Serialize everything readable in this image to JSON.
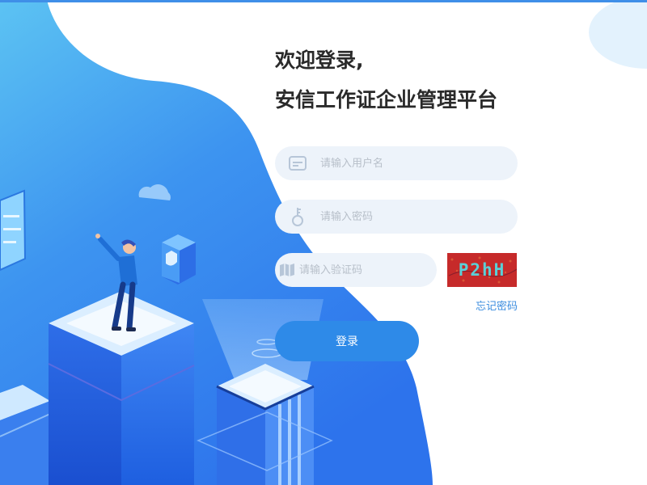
{
  "login": {
    "title_line1": "欢迎登录,",
    "title_line2": "安信工作证企业管理平台",
    "username": {
      "placeholder": "请输入用户名",
      "value": "",
      "icon": "id-card-icon"
    },
    "password": {
      "placeholder": "请输入密码",
      "value": "",
      "icon": "key-icon"
    },
    "captcha_input": {
      "placeholder": "请输入验证码",
      "value": "",
      "icon": "map-icon"
    },
    "captcha_image": {
      "text": "P2hH",
      "icon": "captcha-image"
    },
    "forgot_password": "忘记密码",
    "submit_label": "登录"
  },
  "colors": {
    "accent": "#2e8ae8",
    "field_bg": "#edf3fa",
    "link": "#3c8ddf",
    "title": "#2a2a2a",
    "captcha_bg": "#c62a2a",
    "captcha_text": "#5ad0d8"
  }
}
